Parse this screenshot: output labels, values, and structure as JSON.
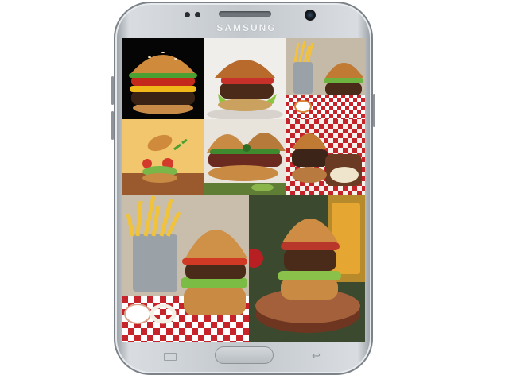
{
  "device": {
    "brand": "SAMSUNG",
    "colors": {
      "body": "#c3c8cc",
      "screen_bg": "#1c1c1c"
    }
  },
  "gallery": {
    "tiles": [
      {
        "name": "burger-on-black",
        "icon": "burger-photo"
      },
      {
        "name": "burger-with-lettuce",
        "icon": "burger-photo"
      },
      {
        "name": "burger-fries-checkered",
        "icon": "burger-photo"
      },
      {
        "name": "exploded-burger",
        "icon": "burger-photo"
      },
      {
        "name": "burger-jalapeno-pickles",
        "icon": "burger-photo"
      },
      {
        "name": "burger-coleslaw-checkered",
        "icon": "burger-photo"
      },
      {
        "name": "burger-fries-bucket",
        "icon": "burger-photo"
      },
      {
        "name": "burger-on-wood-board",
        "icon": "burger-photo"
      }
    ]
  },
  "nav": {
    "recent_icon": "recent-apps-icon",
    "home_icon": "home-button",
    "back_icon": "back-icon"
  }
}
